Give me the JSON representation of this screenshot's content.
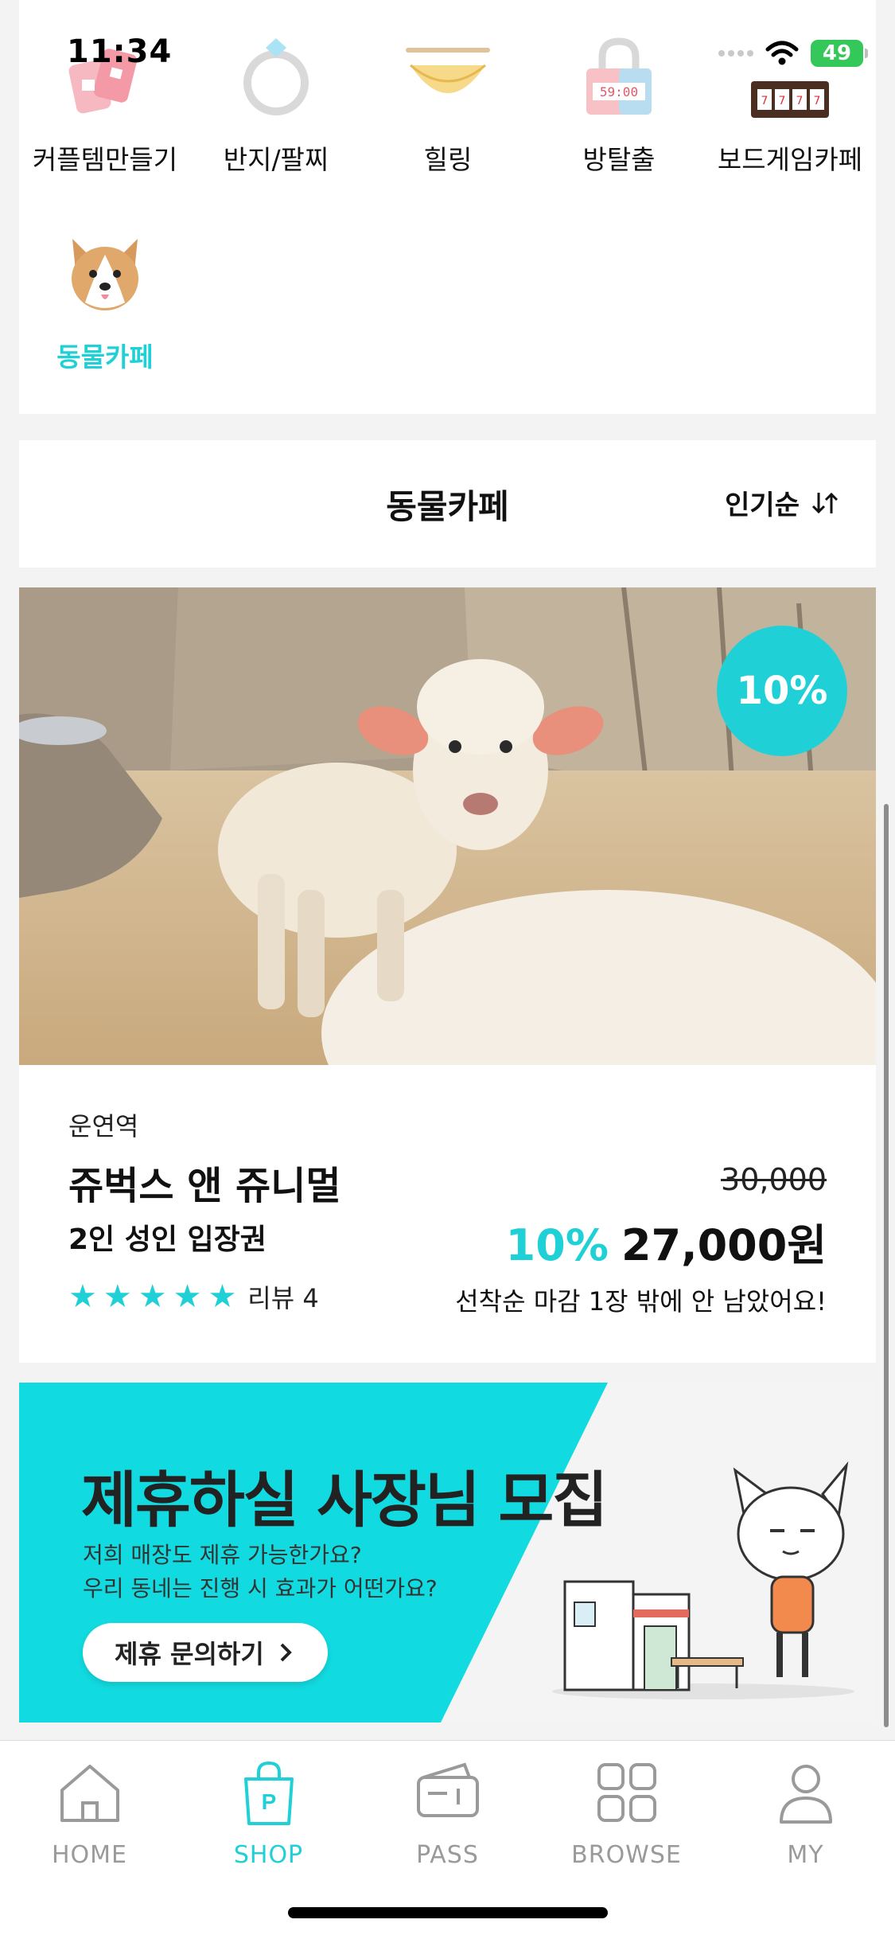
{
  "status_bar": {
    "time": "11:34",
    "battery": "49"
  },
  "categories": [
    {
      "label": "커플템만들기",
      "icon": "couple-item-icon"
    },
    {
      "label": "반지/팔찌",
      "icon": "ring-icon"
    },
    {
      "label": "힐링",
      "icon": "hammock-icon"
    },
    {
      "label": "방탈출",
      "icon": "escape-room-lock-icon"
    },
    {
      "label": "보드게임카페",
      "icon": "slot-machine-icon"
    },
    {
      "label": "동물카페",
      "icon": "dog-icon",
      "active": true
    }
  ],
  "section": {
    "title": "동물카페",
    "sort_label": "인기순"
  },
  "product": {
    "discount_badge": "10%",
    "location": "운연역",
    "name": "쥬벅스 앤 쥬니멀",
    "option": "2인 성인 입장권",
    "rating_stars": 5,
    "review_label": "리뷰 4",
    "original_price": "30,000",
    "discount_percent": "10%",
    "price": "27,000원",
    "stock_notice": "선착순 마감 1장 밖에 안 남았어요!"
  },
  "banner": {
    "title": "제휴하실 사장님 모집",
    "subtitle_line1": "저희 매장도 제휴 가능한가요?",
    "subtitle_line2": "우리 동네는 진행 시 효과가 어떤가요?",
    "button_label": "제휴 문의하기"
  },
  "tabs": [
    {
      "label": "HOME",
      "icon": "home-icon"
    },
    {
      "label": "SHOP",
      "icon": "shopping-bag-icon",
      "active": true
    },
    {
      "label": "PASS",
      "icon": "ticket-icon"
    },
    {
      "label": "BROWSE",
      "icon": "grid-icon"
    },
    {
      "label": "MY",
      "icon": "person-icon"
    }
  ],
  "colors": {
    "accent": "#1fd1d6",
    "inactive_tab": "#9a9a9a",
    "battery": "#34c759"
  }
}
